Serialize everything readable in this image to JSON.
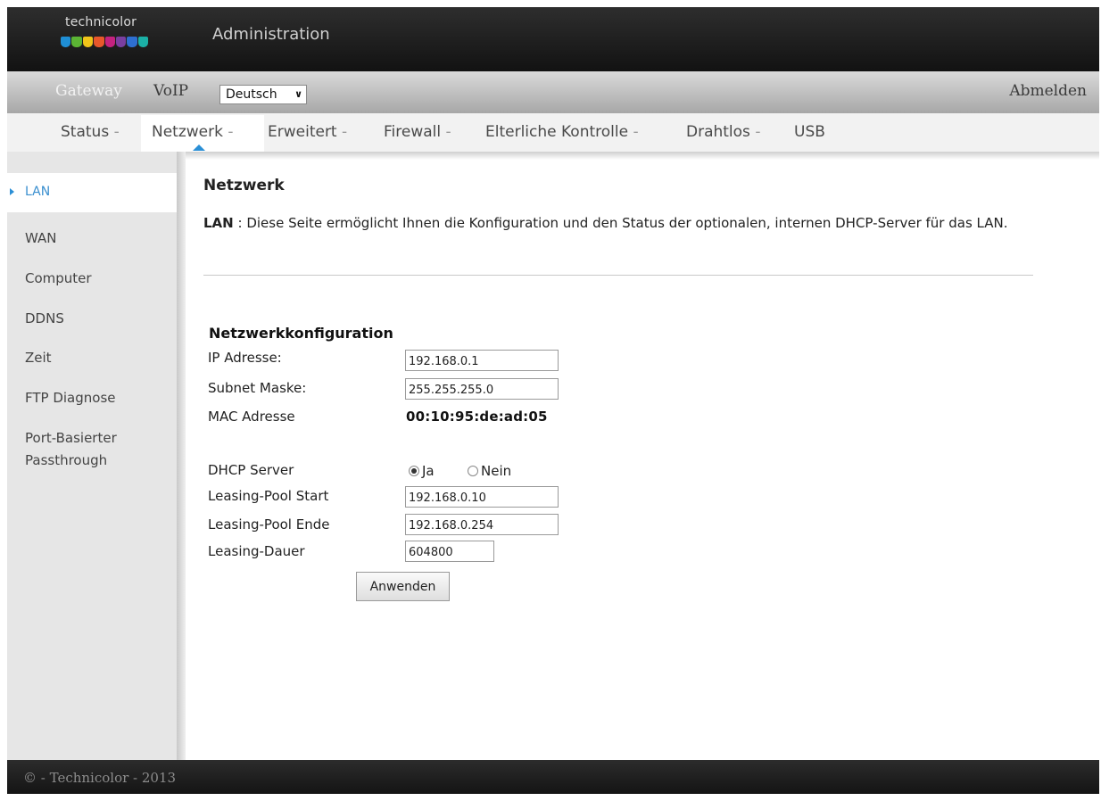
{
  "header": {
    "logo_text": "technicolor",
    "title": "Administration",
    "logo_colors": [
      "#1f8fd6",
      "#5bb434",
      "#f0c419",
      "#e8582b",
      "#c4227f",
      "#7a3fa0",
      "#2e6fd1",
      "#1bb0a6"
    ]
  },
  "mainnav": {
    "items": [
      "Gateway",
      "VoIP"
    ],
    "language": "Deutsch",
    "logout": "Abmelden"
  },
  "subnav": {
    "tabs": [
      {
        "label": "Status",
        "sep": " -"
      },
      {
        "label": "Netzwerk",
        "sep": " -"
      },
      {
        "label": "Erweitert",
        "sep": " -"
      },
      {
        "label": "Firewall",
        "sep": " -"
      },
      {
        "label": "Elterliche Kontrolle",
        "sep": " -"
      },
      {
        "label": "Drahtlos",
        "sep": " -"
      },
      {
        "label": "USB",
        "sep": ""
      }
    ],
    "active": "Netzwerk"
  },
  "sidebar": {
    "items": [
      "LAN",
      "WAN",
      "Computer",
      "DDNS",
      "Zeit",
      "FTP Diagnose",
      "Port-Basierter",
      "Passthrough"
    ],
    "active": "LAN"
  },
  "content": {
    "heading": "Netzwerk",
    "desc_label": "LAN",
    "desc_text": " :  Diese Seite ermöglicht Ihnen die Konfiguration und den Status der optionalen, internen DHCP-Server für das LAN.",
    "section_title": "Netzwerkkonfiguration",
    "fields": {
      "ip_label": "IP Adresse:",
      "ip_value": "192.168.0.1",
      "subnet_label": "Subnet Maske:",
      "subnet_value": "255.255.255.0",
      "mac_label": "MAC Adresse",
      "mac_value": "00:10:95:de:ad:05",
      "dhcp_label": "DHCP Server",
      "dhcp_yes": "Ja",
      "dhcp_no": "Nein",
      "dhcp_selected": "Ja",
      "pool_start_label": "Leasing-Pool Start",
      "pool_start_value": "192.168.0.10",
      "pool_end_label": "Leasing-Pool Ende",
      "pool_end_value": "192.168.0.254",
      "lease_label": "Leasing-Dauer",
      "lease_value": "604800"
    },
    "apply_label": "Anwenden"
  },
  "footer": {
    "text": "© - Technicolor - 2013"
  }
}
